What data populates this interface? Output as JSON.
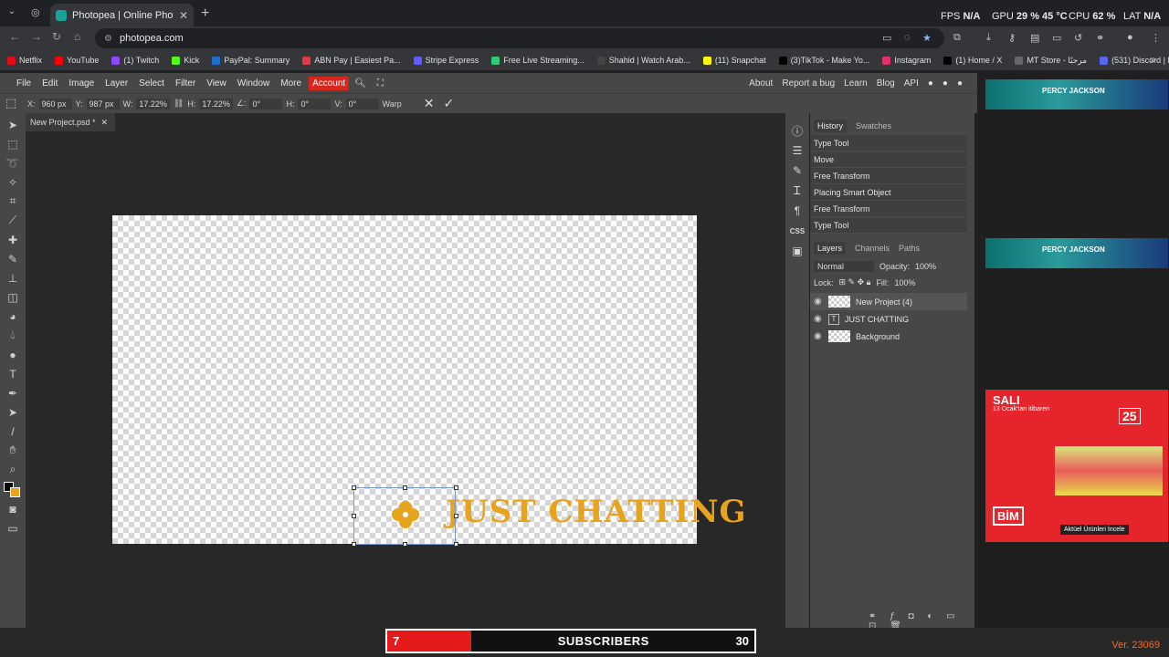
{
  "browser": {
    "tab_title": "Photopea | Online Photo Editor",
    "url": "photopea.com",
    "stats": {
      "fps_label": "FPS",
      "fps_value": "N/A",
      "gpu_label": "GPU",
      "gpu_value": "29 %  45 °C",
      "cpu_label": "CPU",
      "cpu_value": "62 %",
      "lat_label": "LAT",
      "lat_value": "N/A"
    },
    "bookmarks": [
      {
        "label": "Netflix",
        "color": "#e50914"
      },
      {
        "label": "YouTube",
        "color": "#ff0000"
      },
      {
        "label": "(1) Twitch",
        "color": "#9146ff"
      },
      {
        "label": "Kick",
        "color": "#53fc18"
      },
      {
        "label": "PayPal: Summary",
        "color": "#1f6fd1"
      },
      {
        "label": "ABN Pay | Easiest Pa...",
        "color": "#e63946"
      },
      {
        "label": "Stripe Express",
        "color": "#635bff"
      },
      {
        "label": "Free Live Streaming...",
        "color": "#2ecc71"
      },
      {
        "label": "Shahid | Watch Arab...",
        "color": "#444"
      },
      {
        "label": "(11) Snapchat",
        "color": "#fffc00"
      },
      {
        "label": "(3)TikTok - Make Yo...",
        "color": "#000"
      },
      {
        "label": "Instagram",
        "color": "#e1306c"
      },
      {
        "label": "(1) Home / X",
        "color": "#000"
      },
      {
        "label": "MT Store - مرحبًا",
        "color": "#666"
      },
      {
        "label": "(531) Discord | Frien...",
        "color": "#5865f2"
      }
    ]
  },
  "menu": {
    "items": [
      "File",
      "Edit",
      "Image",
      "Layer",
      "Select",
      "Filter",
      "View",
      "Window",
      "More"
    ],
    "account": "Account",
    "right": [
      "About",
      "Report a bug",
      "Learn",
      "Blog",
      "API"
    ]
  },
  "options": {
    "x_label": "X:",
    "x": "960 px",
    "y_label": "Y:",
    "y": "987 px",
    "w_label": "W:",
    "w": "17.22%",
    "h_label": "H:",
    "h": "17.22%",
    "a_label": "∠:",
    "a": "0°",
    "hs_label": "H:",
    "hs": "0°",
    "vs_label": "V:",
    "vs": "0°",
    "warp": "Warp"
  },
  "document": {
    "tab": "New Project.psd *",
    "canvas_text": "JUST CHATTING"
  },
  "history": {
    "tabs": [
      "History",
      "Swatches"
    ],
    "items": [
      "Type Tool",
      "Move",
      "Free Transform",
      "Placing Smart Object",
      "Free Transform",
      "Type Tool"
    ]
  },
  "layers": {
    "tabs": [
      "Layers",
      "Channels",
      "Paths"
    ],
    "blend": "Normal",
    "opacity_label": "Opacity:",
    "opacity": "100%",
    "lock_label": "Lock:",
    "fill_label": "Fill:",
    "fill": "100%",
    "items": [
      "New Project (4)",
      "JUST CHATTING",
      "Background"
    ]
  },
  "subscribers": {
    "left": "7",
    "label": "SUBSCRIBERS",
    "right": "30"
  },
  "version": "Ver. 23069",
  "colors": {
    "accent_red": "#d7261e",
    "text_orange": "#e8a31c"
  }
}
